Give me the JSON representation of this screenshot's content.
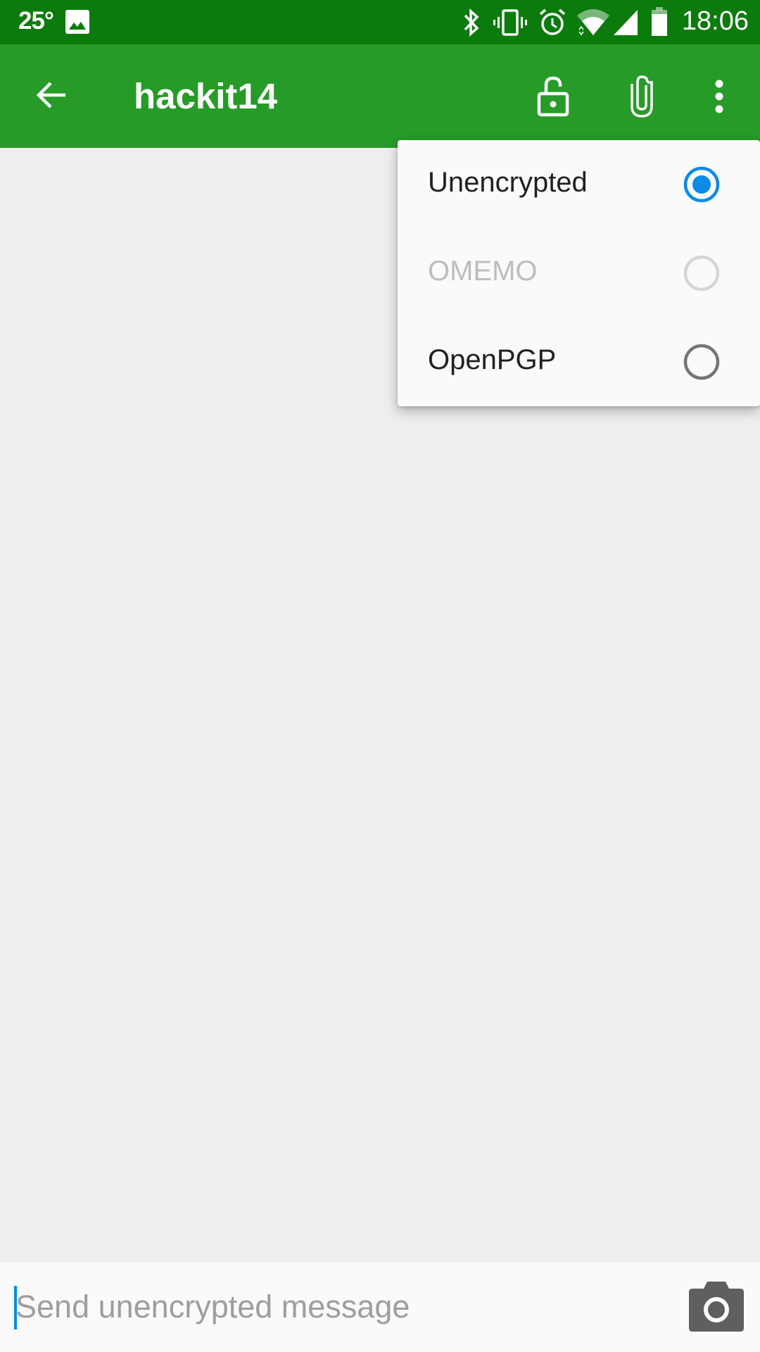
{
  "status_bar": {
    "temperature": "25°",
    "time": "18:06",
    "icons": [
      "image-notification-icon",
      "bluetooth-icon",
      "vibrate-icon",
      "alarm-icon",
      "wifi-icon",
      "cell-signal-icon",
      "battery-icon"
    ]
  },
  "toolbar": {
    "title": "hackit14",
    "back_icon": "arrow-back-icon",
    "actions": [
      "lock-open-icon",
      "attach-icon",
      "more-vert-icon"
    ]
  },
  "encryption_menu": {
    "items": [
      {
        "label": "Unencrypted",
        "selected": true,
        "enabled": true
      },
      {
        "label": "OMEMO",
        "selected": false,
        "enabled": false
      },
      {
        "label": "OpenPGP",
        "selected": false,
        "enabled": true
      }
    ]
  },
  "composer": {
    "placeholder": "Send unencrypted message",
    "value": "",
    "camera_icon": "camera-icon"
  },
  "colors": {
    "status_bar": "#0b7b0b",
    "toolbar": "#279b27",
    "accent": "#0a8ce8",
    "background": "#eeeeee"
  }
}
